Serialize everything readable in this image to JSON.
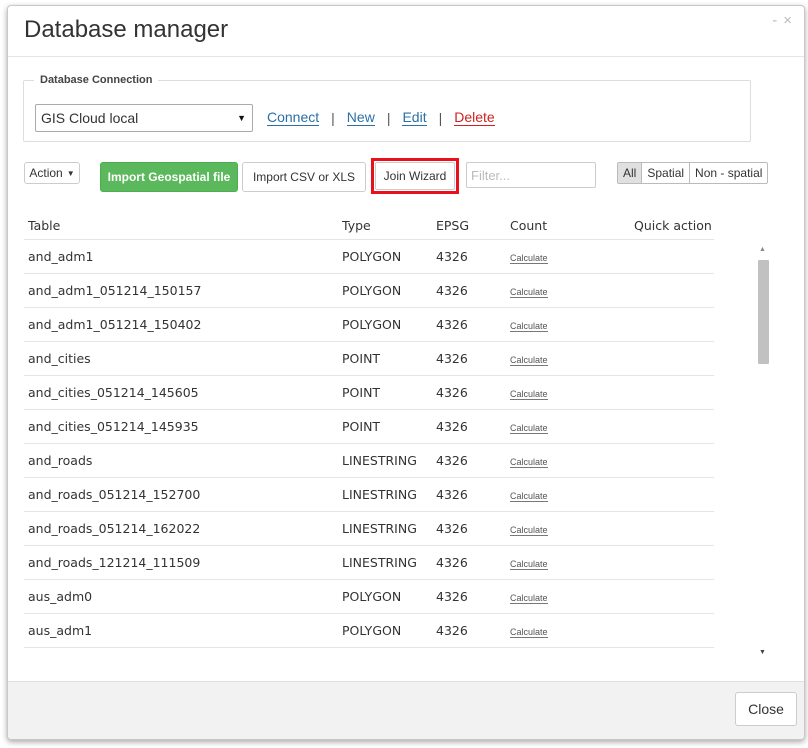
{
  "dialog": {
    "title": "Database manager",
    "minimize_glyph": "-",
    "close_glyph": "×"
  },
  "connection": {
    "legend": "Database Connection",
    "selected": "GIS Cloud local",
    "links": {
      "connect": "Connect",
      "new": "New",
      "edit": "Edit",
      "delete": "Delete"
    },
    "separator": "|"
  },
  "toolbar": {
    "action_label": "Action",
    "import_geo_label": "Import Geospatial file",
    "import_csv_label": "Import CSV or XLS",
    "join_wizard_label": "Join Wizard",
    "filter_placeholder": "Filter...",
    "filters": [
      "All",
      "Spatial",
      "Non - spatial"
    ],
    "active_filter": "All",
    "highlight_color": "#e8101a"
  },
  "table": {
    "headers": [
      "Table",
      "Type",
      "EPSG",
      "Count",
      "Quick action"
    ],
    "calculate_label": "Calculate",
    "rows": [
      {
        "name": "and_adm1",
        "type": "POLYGON",
        "epsg": "4326"
      },
      {
        "name": "and_adm1_051214_150157",
        "type": "POLYGON",
        "epsg": "4326"
      },
      {
        "name": "and_adm1_051214_150402",
        "type": "POLYGON",
        "epsg": "4326"
      },
      {
        "name": "and_cities",
        "type": "POINT",
        "epsg": "4326"
      },
      {
        "name": "and_cities_051214_145605",
        "type": "POINT",
        "epsg": "4326"
      },
      {
        "name": "and_cities_051214_145935",
        "type": "POINT",
        "epsg": "4326"
      },
      {
        "name": "and_roads",
        "type": "LINESTRING",
        "epsg": "4326"
      },
      {
        "name": "and_roads_051214_152700",
        "type": "LINESTRING",
        "epsg": "4326"
      },
      {
        "name": "and_roads_051214_162022",
        "type": "LINESTRING",
        "epsg": "4326"
      },
      {
        "name": "and_roads_121214_111509",
        "type": "LINESTRING",
        "epsg": "4326"
      },
      {
        "name": "aus_adm0",
        "type": "POLYGON",
        "epsg": "4326"
      },
      {
        "name": "aus_adm1",
        "type": "POLYGON",
        "epsg": "4326"
      }
    ]
  },
  "footer": {
    "close_label": "Close"
  },
  "colors": {
    "primary_green": "#5cb85c",
    "link_blue": "#2a6fa6",
    "danger_red": "#cc2222"
  }
}
